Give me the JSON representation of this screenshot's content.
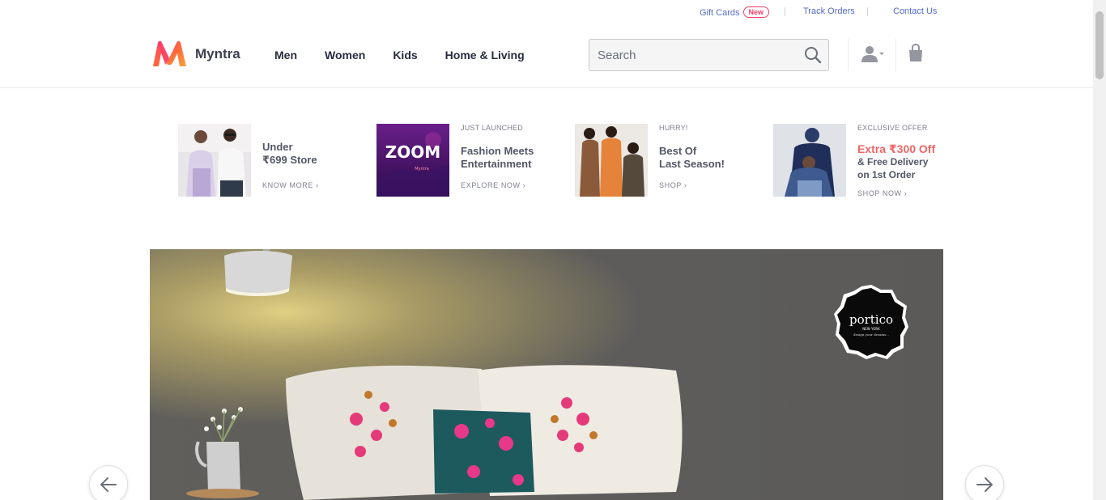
{
  "utility": {
    "gift_cards": "Gift Cards",
    "new_badge": "New",
    "sep": "|",
    "track_orders": "Track Orders",
    "contact_us": "Contact Us"
  },
  "header": {
    "logo_text": "Myntra",
    "nav": [
      "Men",
      "Women",
      "Kids",
      "Home & Living"
    ],
    "search_placeholder": "Search"
  },
  "promos": [
    {
      "kicker": "",
      "title_lines": [
        "Under",
        "₹699 Store"
      ],
      "cta": "KNOW MORE ›"
    },
    {
      "kicker": "JUST LAUNCHED",
      "title_lines": [
        "Fashion Meets",
        "Entertainment"
      ],
      "cta": "EXPLORE NOW ›",
      "image_text": "ZOOM",
      "image_subtext": "Myntra"
    },
    {
      "kicker": "HURRY!",
      "title_lines": [
        "Best Of",
        "Last Season!"
      ],
      "cta": "SHOP ›"
    },
    {
      "kicker": "EXCLUSIVE OFFER",
      "title_lines": [
        "Extra ₹300 Off",
        "& Free Delivery",
        "on 1st Order"
      ],
      "cta": "SHOP NOW ›"
    }
  ],
  "hero": {
    "brand_logo": "portico",
    "brand_sub": "NEW YORK",
    "brand_tag": "design your dreams..."
  },
  "colors": {
    "brand_pink": "#ff3f6c",
    "link_blue": "#526cd0",
    "offer_red": "#f16565"
  }
}
